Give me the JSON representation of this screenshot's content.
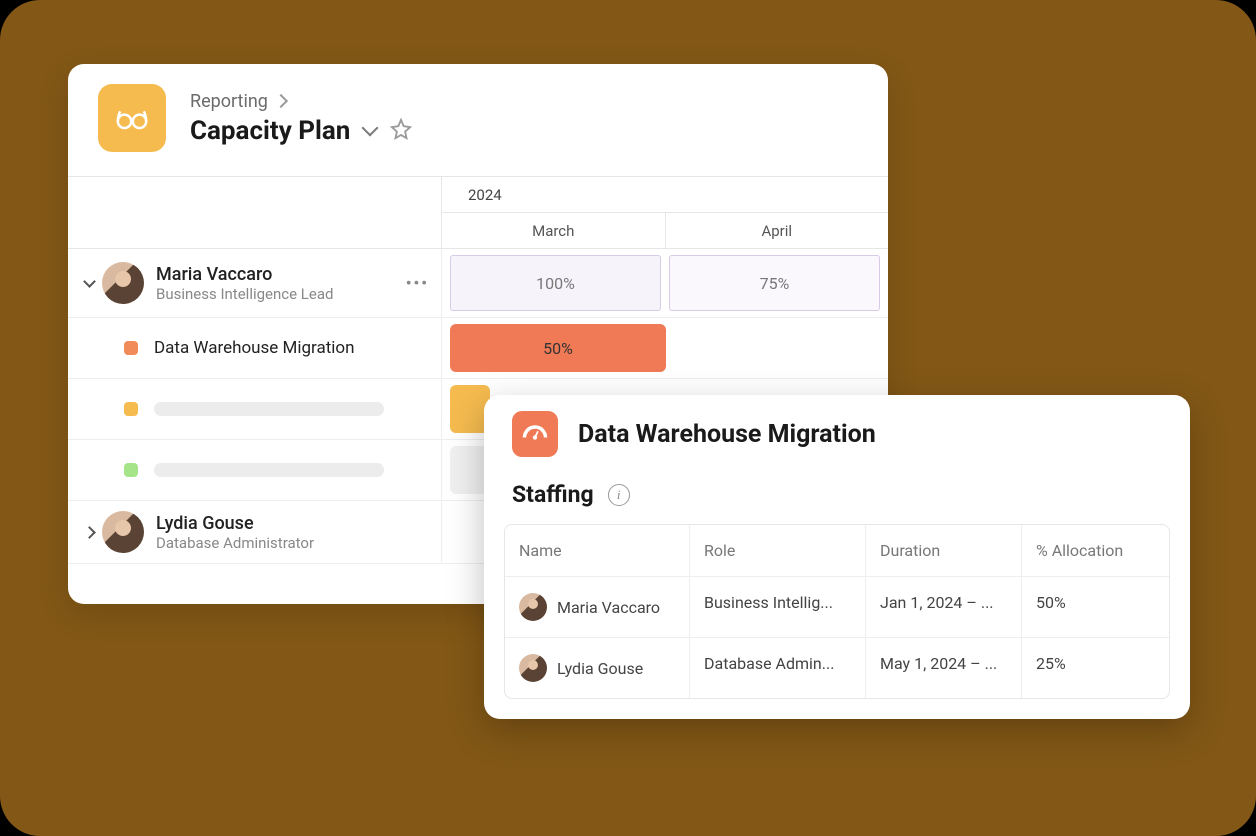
{
  "card1": {
    "breadcrumb": "Reporting",
    "title": "Capacity Plan",
    "timeline": {
      "year": "2024",
      "months": [
        "March",
        "April"
      ]
    },
    "people": [
      {
        "name": "Maria Vaccaro",
        "role": "Business Intelligence Lead",
        "expanded": true,
        "allocations": [
          "100%",
          "75%"
        ],
        "tasks": [
          {
            "color": "orange",
            "label": "Data Warehouse Migration",
            "bar_label": "50%"
          },
          {
            "color": "yellow",
            "label": "",
            "bar_label": ""
          },
          {
            "color": "green",
            "label": "",
            "bar_label": ""
          }
        ]
      },
      {
        "name": "Lydia Gouse",
        "role": "Database Administrator",
        "expanded": false
      }
    ]
  },
  "card2": {
    "title": "Data Warehouse Migration",
    "section": "Staffing",
    "columns": [
      "Name",
      "Role",
      "Duration",
      "% Allocation"
    ],
    "rows": [
      {
        "name": "Maria Vaccaro",
        "role": "Business Intellig...",
        "duration": "Jan 1, 2024 – ...",
        "allocation": "50%"
      },
      {
        "name": "Lydia Gouse",
        "role": "Database Admin...",
        "duration": "May 1, 2024 – ...",
        "allocation": "25%"
      }
    ]
  }
}
